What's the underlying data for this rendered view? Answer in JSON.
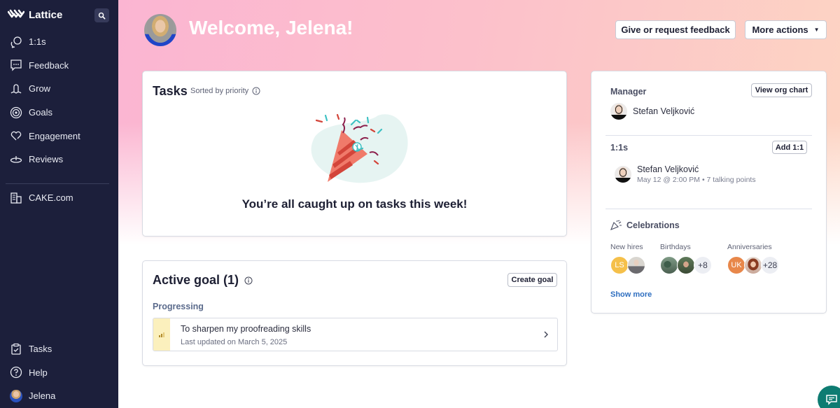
{
  "sidebar": {
    "brand": "Lattice",
    "search_icon": "search-icon",
    "items": [
      {
        "label": "1:1s",
        "icon": "chat-bubbles-icon"
      },
      {
        "label": "Feedback",
        "icon": "message-dots-icon"
      },
      {
        "label": "Grow",
        "icon": "grow-icon"
      },
      {
        "label": "Goals",
        "icon": "target-icon"
      },
      {
        "label": "Engagement",
        "icon": "heart-icon"
      },
      {
        "label": "Reviews",
        "icon": "reviews-icon"
      }
    ],
    "org": {
      "label": "CAKE.com",
      "icon": "building-icon"
    },
    "bottom": [
      {
        "label": "Tasks",
        "icon": "clipboard-check-icon"
      },
      {
        "label": "Help",
        "icon": "question-circle-icon"
      },
      {
        "label": "Jelena",
        "icon": "avatar"
      }
    ]
  },
  "header": {
    "welcome": "Welcome, Jelena!",
    "feedback_button": "Give or request feedback",
    "more_actions_button": "More actions",
    "more_actions_caret": "▼"
  },
  "tasks": {
    "title": "Tasks",
    "sorted_label": "Sorted by priority",
    "empty_message": "You’re all caught up on tasks this week!"
  },
  "goals": {
    "title": "Active goal (1)",
    "create_button": "Create goal",
    "group_label": "Progressing",
    "items": [
      {
        "name": "To sharpen my proofreading skills",
        "updated": "Last updated on March 5, 2025"
      }
    ]
  },
  "side": {
    "manager_label": "Manager",
    "view_org_chart": "View org chart",
    "manager_name": "Stefan Veljković",
    "ones_label": "1:1s",
    "add_one": "Add 1:1",
    "one_on_one": {
      "name": "Stefan Veljković",
      "meta": "May 12 @ 2:00 PM • 7 talking points"
    },
    "celebrations_label": "Celebrations",
    "groups": [
      {
        "label": "New hires",
        "initials": [
          "LS"
        ],
        "extra": ""
      },
      {
        "label": "Birthdays",
        "initials": [],
        "extra": "+8"
      },
      {
        "label": "Anniversaries",
        "initials": [
          "UK"
        ],
        "extra": "+28"
      }
    ],
    "show_more": "Show more"
  },
  "colors": {
    "sidebar_bg": "#1c1f3b",
    "accent_link": "#2f6fc0",
    "chat_fab": "#0e7c72",
    "goal_strip": "#fbf0bd"
  }
}
